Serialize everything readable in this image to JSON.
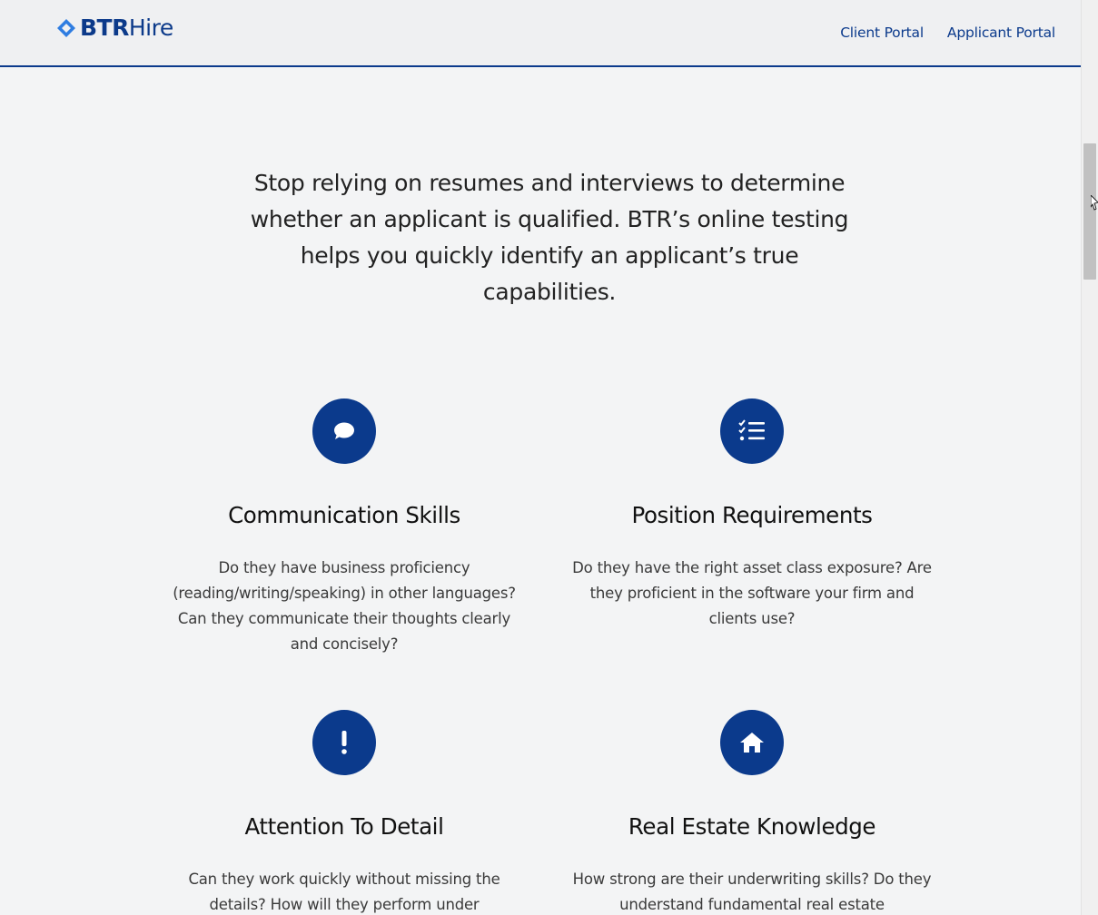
{
  "brand": {
    "name_bold": "BTR",
    "name_light": "Hire",
    "color": "#0b3a8c",
    "logo_icon": "diamond-logo-icon"
  },
  "nav": {
    "client_portal": "Client Portal",
    "applicant_portal": "Applicant Portal"
  },
  "intro": {
    "text": "Stop relying on resumes and interviews to determine whether an applicant is qualified. BTR’s online testing helps you quickly identify an applicant’s true capabilities."
  },
  "features": [
    {
      "icon": "speech-bubble-icon",
      "title": "Communication Skills",
      "description": "Do they have business proficiency (reading/writing/speaking) in other languages? Can they communicate their thoughts clearly and concisely?"
    },
    {
      "icon": "checklist-icon",
      "title": "Position Requirements",
      "description": "Do they have the right asset class exposure? Are they proficient in the software your firm and clients use?"
    },
    {
      "icon": "exclamation-icon",
      "title": "Attention To Detail",
      "description": "Can they work quickly without missing the details? How will they perform under"
    },
    {
      "icon": "home-icon",
      "title": "Real Estate Knowledge",
      "description": "How strong are their underwriting skills? Do they understand fundamental real estate"
    }
  ],
  "colors": {
    "accent": "#0b3a8c",
    "background": "#f3f4f5",
    "header_bg": "#eff0f2"
  }
}
